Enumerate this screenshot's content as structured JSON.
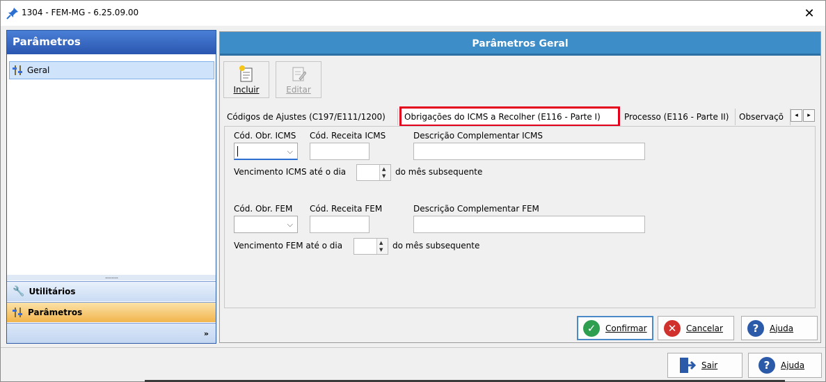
{
  "window": {
    "title": "1304 - FEM-MG - 6.25.09.00",
    "close_glyph": "✕"
  },
  "left_panel": {
    "header": "Parâmetros",
    "tree_items": [
      {
        "label": "Geral",
        "icon": "sliders-icon",
        "selected": true
      }
    ],
    "splitter_glyph": "..........",
    "nav_buttons": [
      {
        "label": "Utilitários",
        "icon": "wrench-icon"
      },
      {
        "label": "Parâmetros",
        "icon": "sliders-icon",
        "active": true
      }
    ],
    "more_glyph": "»"
  },
  "right_panel": {
    "header": "Parâmetros Geral",
    "toolbar": {
      "include_label": "Incluir",
      "edit_label": "Editar"
    },
    "tabs": [
      {
        "label": "Códigos de Ajustes (C197/E111/1200)"
      },
      {
        "label": "Obrigações do ICMS a Recolher (E116 - Parte I)",
        "active": true
      },
      {
        "label": "Processo (E116 - Parte II)"
      },
      {
        "label": "Observaçõ"
      }
    ],
    "tab_scroll": {
      "left": "◂",
      "right": "▸"
    },
    "icms": {
      "cod_obr_label": "Cód. Obr. ICMS",
      "cod_obr_value": "",
      "cod_receita_label": "Cód. Receita ICMS",
      "cod_receita_value": "",
      "descricao_label": "Descrição Complementar ICMS",
      "descricao_value": "",
      "vencimento_label": "Vencimento ICMS até o dia",
      "vencimento_value": "",
      "vencimento_suffix": "do mês subsequente"
    },
    "fem": {
      "cod_obr_label": "Cód. Obr. FEM",
      "cod_obr_value": "",
      "cod_receita_label": "Cód. Receita FEM",
      "cod_receita_value": "",
      "descricao_label": "Descrição Complementar FEM",
      "descricao_value": "",
      "vencimento_label": "Vencimento FEM até o dia",
      "vencimento_value": "",
      "vencimento_suffix": "do mês subsequente"
    },
    "actions": {
      "confirm_label": "Confirmar",
      "cancel_label": "Cancelar",
      "help_label": "Ajuda"
    }
  },
  "bottom": {
    "exit_label": "Sair",
    "help_label": "Ajuda"
  },
  "colors": {
    "header_blue": "#3c8dc8",
    "left_header": "#2a56b0",
    "highlight_red": "#e3001b",
    "confirm_green": "#2e9e4f",
    "cancel_red": "#d0312d",
    "help_blue": "#2b5aa8"
  },
  "icons": {
    "chevron": "⌵",
    "spin_up": "▲",
    "spin_down": "▼",
    "confirm": "✓",
    "cancel": "✕",
    "help": "?"
  }
}
